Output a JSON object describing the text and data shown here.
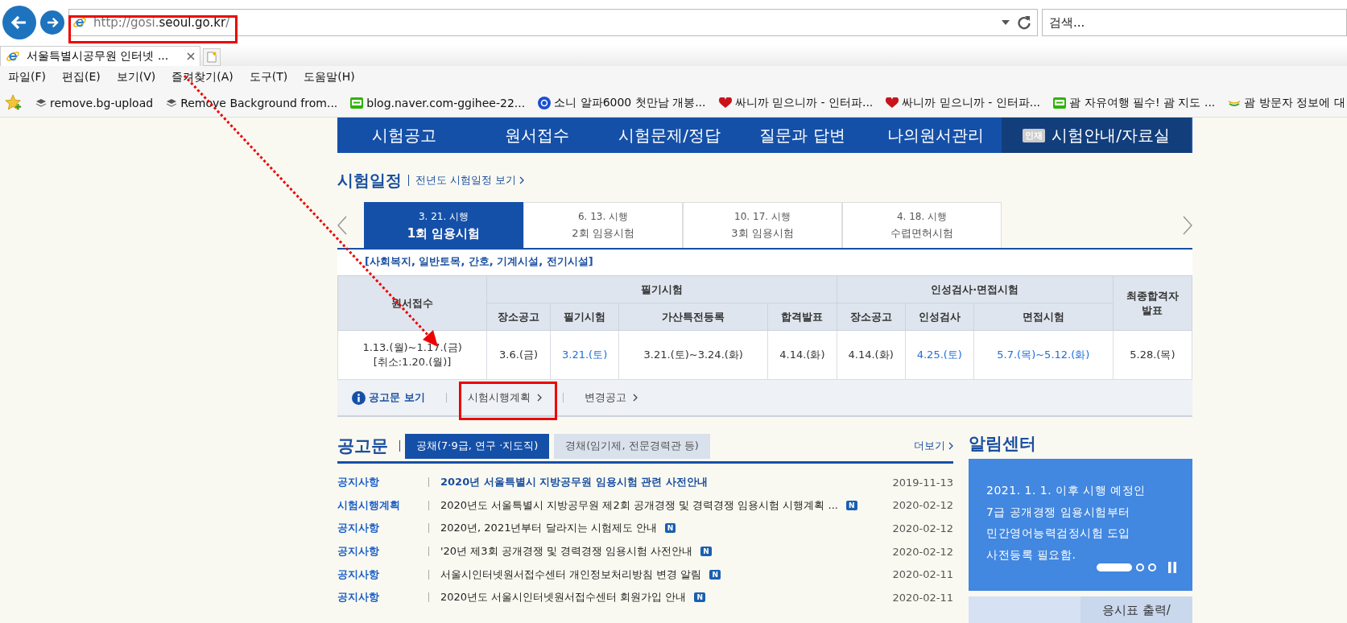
{
  "browser": {
    "address": {
      "url_parts": [
        {
          "text": "http://gosi.",
          "strong": false
        },
        {
          "text": "seoul.go.kr",
          "strong": true
        },
        {
          "text": "/",
          "strong": false
        }
      ]
    },
    "search": {
      "placeholder": "검색..."
    },
    "tabs": [
      {
        "title": "서울특별시공무원 인터넷 ...",
        "selected": true
      }
    ],
    "menu": [
      "파일(F)",
      "편집(E)",
      "보기(V)",
      "즐겨찾기(A)",
      "도구(T)",
      "도움말(H)"
    ],
    "favorites": [
      {
        "kind": "layers",
        "label": "remove.bg-upload"
      },
      {
        "kind": "layers",
        "label": "Remove Background from..."
      },
      {
        "kind": "blog",
        "label": "blog.naver.com-ggihee-22..."
      },
      {
        "kind": "circle",
        "label": "소니 알파6000 첫만남 개봉..."
      },
      {
        "kind": "heart",
        "label": "싸니까 믿으니까 - 인터파..."
      },
      {
        "kind": "heart",
        "label": "싸니까 믿으니까 - 인터파..."
      },
      {
        "kind": "blog",
        "label": "괌 자유여행 필수! 괌 지도 ..."
      },
      {
        "kind": "swirl",
        "label": "괌  방문자 정보에 대"
      }
    ]
  },
  "nav": {
    "items": [
      {
        "label": "시험공고",
        "selected": false
      },
      {
        "label": "원서접수",
        "selected": false
      },
      {
        "label": "시험문제/정답",
        "selected": false
      },
      {
        "label": "질문과 답변",
        "selected": false
      },
      {
        "label": "나의원서관리",
        "selected": false
      },
      {
        "label": "시험안내/자료실",
        "selected": true,
        "badge": "인재"
      }
    ]
  },
  "schedule": {
    "title": "시험일정",
    "link": "전년도 시험일정 보기",
    "tabs": [
      {
        "date": "3. 21. 시행",
        "name": "1회 임용시험",
        "selected": true
      },
      {
        "date": "6. 13. 시행",
        "name": "2회 임용시험",
        "selected": false
      },
      {
        "date": "10. 17. 시행",
        "name": "3회 임용시험",
        "selected": false
      },
      {
        "date": "4. 18. 시행",
        "name": "수렵면허시험",
        "selected": false
      }
    ],
    "category": "[사회복지, 일반토목, 간호, 기계시설, 전기시설]",
    "table": {
      "columns": [
        {
          "label": "원서접수"
        },
        {
          "label": "필기시험",
          "children": [
            {
              "label": "장소공고"
            },
            {
              "label": "필기시험"
            },
            {
              "label": "가산특전등록"
            },
            {
              "label": "합격발표"
            }
          ]
        },
        {
          "label": "인성검사·면접시험",
          "children": [
            {
              "label": "장소공고"
            },
            {
              "label": "인성검사"
            },
            {
              "label": "면접시험"
            }
          ]
        },
        {
          "label": "최종합격자\n발표"
        }
      ],
      "row": [
        {
          "text": "1.13.(월)~1.17.(금)\n[취소:1.20.(월)]",
          "highlight": false
        },
        {
          "text": "3.6.(금)",
          "highlight": false
        },
        {
          "text": "3.21.(토)",
          "highlight": true
        },
        {
          "text": "3.21.(토)~3.24.(화)",
          "highlight": false
        },
        {
          "text": "4.14.(화)",
          "highlight": false
        },
        {
          "text": "4.14.(화)",
          "highlight": false
        },
        {
          "text": "4.25.(토)",
          "highlight": true
        },
        {
          "text": "5.7.(목)~5.12.(화)",
          "highlight": true
        },
        {
          "text": "5.28.(목)",
          "highlight": false
        }
      ]
    },
    "footer": {
      "label": "공고문 보기",
      "links": [
        "시험시행계획",
        "변경공고"
      ]
    }
  },
  "notices": {
    "title": "공고문",
    "tabs": [
      {
        "label": "공채(7·9급, 연구 ·지도직)",
        "selected": true
      },
      {
        "label": "경채(임기제, 전문경력관 등)",
        "selected": false
      }
    ],
    "more": "더보기",
    "rows": [
      {
        "category": "공지사항",
        "title": "2020년 서울특별시 지방공무원 임용시험 관련 사전안내",
        "date": "2019-11-13",
        "bold": true
      },
      {
        "category": "시험시행계획",
        "title": "2020년도 서울특별시 지방공무원 제2회 공개경쟁 및 경력경쟁 임용시험 시행계획 ...",
        "date": "2020-02-12",
        "bold": false,
        "badge": "N"
      },
      {
        "category": "공지사항",
        "title": "2020년, 2021년부터 달라지는 시험제도 안내",
        "date": "2020-02-12",
        "bold": false,
        "badge": "N"
      },
      {
        "category": "공지사항",
        "title": "'20년 제3회 공개경쟁 및 경력경쟁 임용시험 사전안내",
        "date": "2020-02-12",
        "bold": false,
        "badge": "N"
      },
      {
        "category": "공지사항",
        "title": "서울시인터넷원서접수센터 개인정보처리방침 변경 알림",
        "date": "2020-02-11",
        "bold": false,
        "badge": "N"
      },
      {
        "category": "공지사항",
        "title": "2020년도 서울시인터넷원서접수센터 회원가입 안내",
        "date": "2020-02-11",
        "bold": false,
        "badge": "N"
      }
    ]
  },
  "alarm": {
    "title": "알림센터",
    "text": "2021. 1. 1. 이후 시행 예정인\n7급 공개경쟁 임용시험부터\n민간영어능력검정시험 도입\n사전등록 필요함.",
    "slides": [
      {
        "selected": true
      },
      {
        "selected": false
      },
      {
        "selected": false
      }
    ],
    "cards": [
      {
        "kind": "plain"
      },
      {
        "kind": "labeled",
        "label": "응시표 출력/"
      }
    ]
  }
}
